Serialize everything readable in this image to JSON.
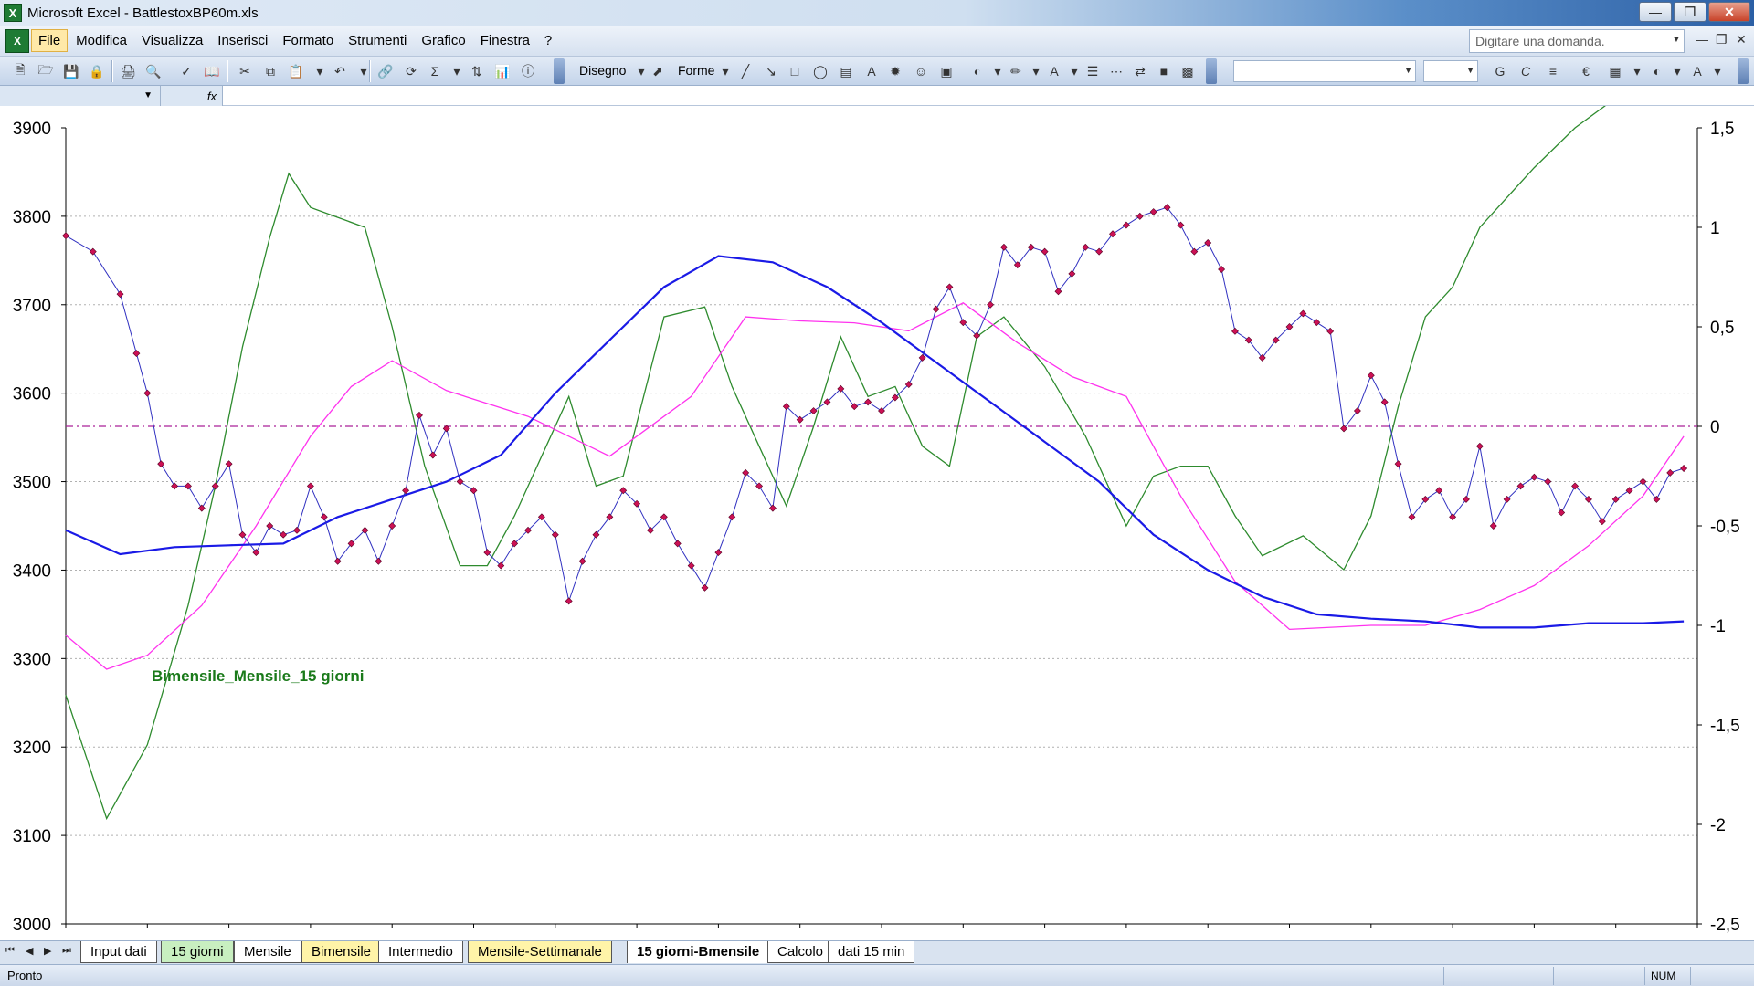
{
  "window": {
    "title": "Microsoft Excel - BattlestoxBP60m.xls",
    "icon_name": "excel-app-icon",
    "controls": [
      "minimize",
      "restore",
      "close"
    ]
  },
  "menu": {
    "items": [
      "File",
      "Modifica",
      "Visualizza",
      "Inserisci",
      "Formato",
      "Strumenti",
      "Grafico",
      "Finestra",
      "?"
    ],
    "active_item": "File",
    "ask_placeholder": "Digitare una domanda."
  },
  "toolbar": {
    "draw_label": "Disegno",
    "shapes_label": "Forme"
  },
  "sheet_tabs": {
    "tabs": [
      {
        "label": "Input dati",
        "color": "#ffffff"
      },
      {
        "label": "15 giorni",
        "color": "#c8efc0"
      },
      {
        "label": "Mensile",
        "color": "#ffffff"
      },
      {
        "label": "Bimensile",
        "color": "#fff4a8"
      },
      {
        "label": "Intermedio",
        "color": "#ffffff"
      },
      {
        "label": "Mensile-Settimanale",
        "color": "#fff4a8"
      },
      {
        "label": "15 giorni-Bmensile",
        "color": "#ffffff",
        "active": true
      },
      {
        "label": "Calcolo",
        "color": "#ffffff"
      },
      {
        "label": "dati 15 min",
        "color": "#ffffff"
      }
    ]
  },
  "status": {
    "text": "Pronto",
    "num_indicator": "NUM"
  },
  "chart_data": {
    "type": "line",
    "title": "",
    "annotation": "Bimensile_Mensile_15 giorni",
    "x_count": 600,
    "y_left": {
      "min": 3000,
      "max": 3900,
      "ticks": [
        "3900",
        "3800",
        "3700",
        "3600",
        "3500",
        "3400",
        "3300",
        "3200",
        "3100",
        "3000"
      ]
    },
    "y_right": {
      "min": -2.5,
      "max": 1.5,
      "ticks": [
        "1,5",
        "1",
        "0,5",
        "0",
        "-0,5",
        "-1",
        "-1,5",
        "-2",
        "-2,5"
      ]
    },
    "grid": true,
    "reference_line": {
      "axis": "right",
      "value": 0,
      "color": "#aa2299"
    },
    "colors": {
      "price": "#3030c0",
      "marker": "#cc1155",
      "blue": "#1a1ae6",
      "magenta": "#ff33ee",
      "green": "#2e8b2e"
    },
    "series": [
      {
        "key": "price",
        "axis": "left",
        "x": [
          0,
          10,
          20,
          26,
          30,
          35,
          40,
          45,
          50,
          55,
          60,
          65,
          70,
          75,
          80,
          85,
          90,
          95,
          100,
          105,
          110,
          115,
          120,
          125,
          130,
          135,
          140,
          145,
          150,
          155,
          160,
          165,
          170,
          175,
          180,
          185,
          190,
          195,
          200,
          205,
          210,
          215,
          220,
          225,
          230,
          235,
          240,
          245,
          250,
          255,
          260,
          265,
          270,
          275,
          280,
          285,
          290,
          295,
          300,
          305,
          310,
          315,
          320,
          325,
          330,
          335,
          340,
          345,
          350,
          355,
          360,
          365,
          370,
          375,
          380,
          385,
          390,
          395,
          400,
          405,
          410,
          415,
          420,
          425,
          430,
          435,
          440,
          445,
          450,
          455,
          460,
          465,
          470,
          475,
          480,
          485,
          490,
          495,
          500,
          505,
          510,
          515,
          520,
          525,
          530,
          535,
          540,
          545,
          550,
          555,
          560,
          565,
          570,
          575,
          580,
          585,
          590,
          595
        ],
        "y": [
          3778,
          3760,
          3712,
          3645,
          3600,
          3520,
          3495,
          3495,
          3470,
          3495,
          3520,
          3440,
          3420,
          3450,
          3440,
          3445,
          3495,
          3460,
          3410,
          3430,
          3445,
          3410,
          3450,
          3490,
          3575,
          3530,
          3560,
          3500,
          3490,
          3420,
          3405,
          3430,
          3445,
          3460,
          3440,
          3365,
          3410,
          3440,
          3460,
          3490,
          3475,
          3445,
          3460,
          3430,
          3405,
          3380,
          3420,
          3460,
          3510,
          3495,
          3470,
          3585,
          3570,
          3580,
          3590,
          3605,
          3585,
          3590,
          3580,
          3595,
          3610,
          3640,
          3695,
          3720,
          3680,
          3665,
          3700,
          3765,
          3745,
          3765,
          3760,
          3715,
          3735,
          3765,
          3760,
          3780,
          3790,
          3800,
          3805,
          3810,
          3790,
          3760,
          3770,
          3740,
          3670,
          3660,
          3640,
          3660,
          3675,
          3690,
          3680,
          3670,
          3560,
          3580,
          3620,
          3590,
          3520,
          3460,
          3480,
          3490,
          3460,
          3480,
          3540,
          3450,
          3480,
          3495,
          3505,
          3500,
          3465,
          3495,
          3480,
          3455,
          3480,
          3490,
          3500,
          3480,
          3510,
          3515
        ]
      },
      {
        "key": "blue",
        "axis": "left",
        "x": [
          0,
          20,
          40,
          60,
          80,
          100,
          120,
          140,
          160,
          180,
          200,
          220,
          240,
          260,
          280,
          300,
          320,
          340,
          360,
          380,
          400,
          420,
          440,
          460,
          480,
          500,
          520,
          540,
          560,
          580,
          595
        ],
        "y": [
          3445,
          3418,
          3426,
          3428,
          3430,
          3460,
          3480,
          3500,
          3530,
          3600,
          3660,
          3720,
          3755,
          3748,
          3720,
          3680,
          3635,
          3590,
          3545,
          3500,
          3440,
          3400,
          3370,
          3350,
          3345,
          3342,
          3335,
          3335,
          3340,
          3340,
          3342
        ]
      },
      {
        "key": "magenta",
        "axis": "right",
        "x": [
          0,
          15,
          30,
          50,
          70,
          90,
          105,
          120,
          140,
          170,
          200,
          230,
          250,
          270,
          290,
          310,
          330,
          350,
          370,
          390,
          410,
          430,
          450,
          480,
          500,
          520,
          540,
          560,
          580,
          595
        ],
        "y": [
          -1.05,
          -1.22,
          -1.15,
          -0.9,
          -0.5,
          -0.05,
          0.2,
          0.33,
          0.18,
          0.05,
          -0.15,
          0.15,
          0.55,
          0.53,
          0.52,
          0.48,
          0.62,
          0.42,
          0.25,
          0.15,
          -0.35,
          -0.78,
          -1.02,
          -1.0,
          -1.0,
          -0.92,
          -0.8,
          -0.6,
          -0.35,
          -0.05
        ]
      },
      {
        "key": "green",
        "axis": "right",
        "x": [
          0,
          15,
          30,
          45,
          55,
          65,
          75,
          82,
          90,
          100,
          110,
          120,
          132,
          145,
          155,
          165,
          175,
          185,
          195,
          205,
          220,
          235,
          245,
          255,
          265,
          275,
          285,
          295,
          305,
          315,
          325,
          335,
          345,
          360,
          375,
          390,
          400,
          410,
          420,
          430,
          440,
          455,
          470,
          480,
          490,
          500,
          510,
          520,
          530,
          540,
          555,
          570,
          585,
          595
        ],
        "y": [
          -1.35,
          -1.97,
          -1.6,
          -0.9,
          -0.3,
          0.4,
          0.95,
          1.27,
          1.1,
          1.05,
          1.0,
          0.5,
          -0.2,
          -0.7,
          -0.7,
          -0.45,
          -0.15,
          0.15,
          -0.3,
          -0.25,
          0.55,
          0.6,
          0.2,
          -0.1,
          -0.4,
          0.0,
          0.45,
          0.15,
          0.2,
          -0.1,
          -0.2,
          0.45,
          0.55,
          0.3,
          -0.05,
          -0.5,
          -0.25,
          -0.2,
          -0.2,
          -0.45,
          -0.65,
          -0.55,
          -0.72,
          -0.45,
          0.1,
          0.55,
          0.7,
          1.0,
          1.15,
          1.3,
          1.5,
          1.65,
          1.8,
          1.9
        ]
      }
    ]
  }
}
